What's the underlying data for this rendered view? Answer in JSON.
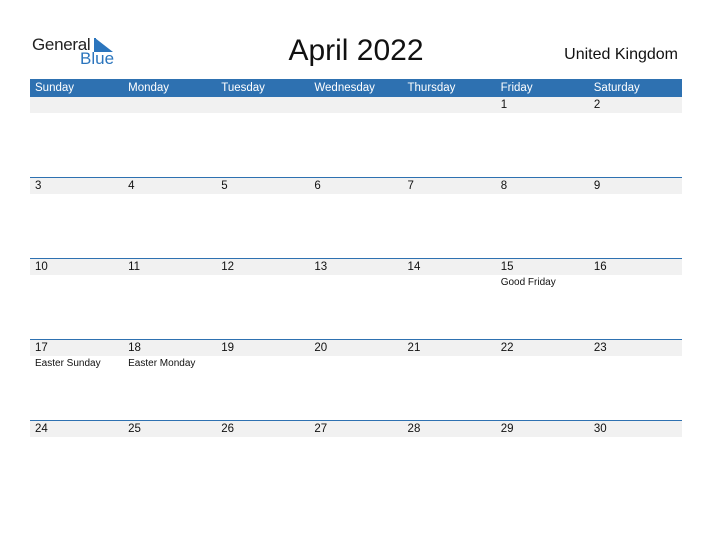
{
  "logo": {
    "word1": "General",
    "word2": "Blue"
  },
  "title": "April 2022",
  "country": "United Kingdom",
  "colors": {
    "accent": "#2e71b1",
    "strip": "#f1f1f1"
  },
  "weekdays": [
    "Sunday",
    "Monday",
    "Tuesday",
    "Wednesday",
    "Thursday",
    "Friday",
    "Saturday"
  ],
  "weeks": [
    [
      {
        "d": ""
      },
      {
        "d": ""
      },
      {
        "d": ""
      },
      {
        "d": ""
      },
      {
        "d": ""
      },
      {
        "d": "1"
      },
      {
        "d": "2"
      }
    ],
    [
      {
        "d": "3"
      },
      {
        "d": "4"
      },
      {
        "d": "5"
      },
      {
        "d": "6"
      },
      {
        "d": "7"
      },
      {
        "d": "8"
      },
      {
        "d": "9"
      }
    ],
    [
      {
        "d": "10"
      },
      {
        "d": "11"
      },
      {
        "d": "12"
      },
      {
        "d": "13"
      },
      {
        "d": "14"
      },
      {
        "d": "15",
        "e": "Good Friday"
      },
      {
        "d": "16"
      }
    ],
    [
      {
        "d": "17",
        "e": "Easter Sunday"
      },
      {
        "d": "18",
        "e": "Easter Monday"
      },
      {
        "d": "19"
      },
      {
        "d": "20"
      },
      {
        "d": "21"
      },
      {
        "d": "22"
      },
      {
        "d": "23"
      }
    ],
    [
      {
        "d": "24"
      },
      {
        "d": "25"
      },
      {
        "d": "26"
      },
      {
        "d": "27"
      },
      {
        "d": "28"
      },
      {
        "d": "29"
      },
      {
        "d": "30"
      }
    ]
  ]
}
